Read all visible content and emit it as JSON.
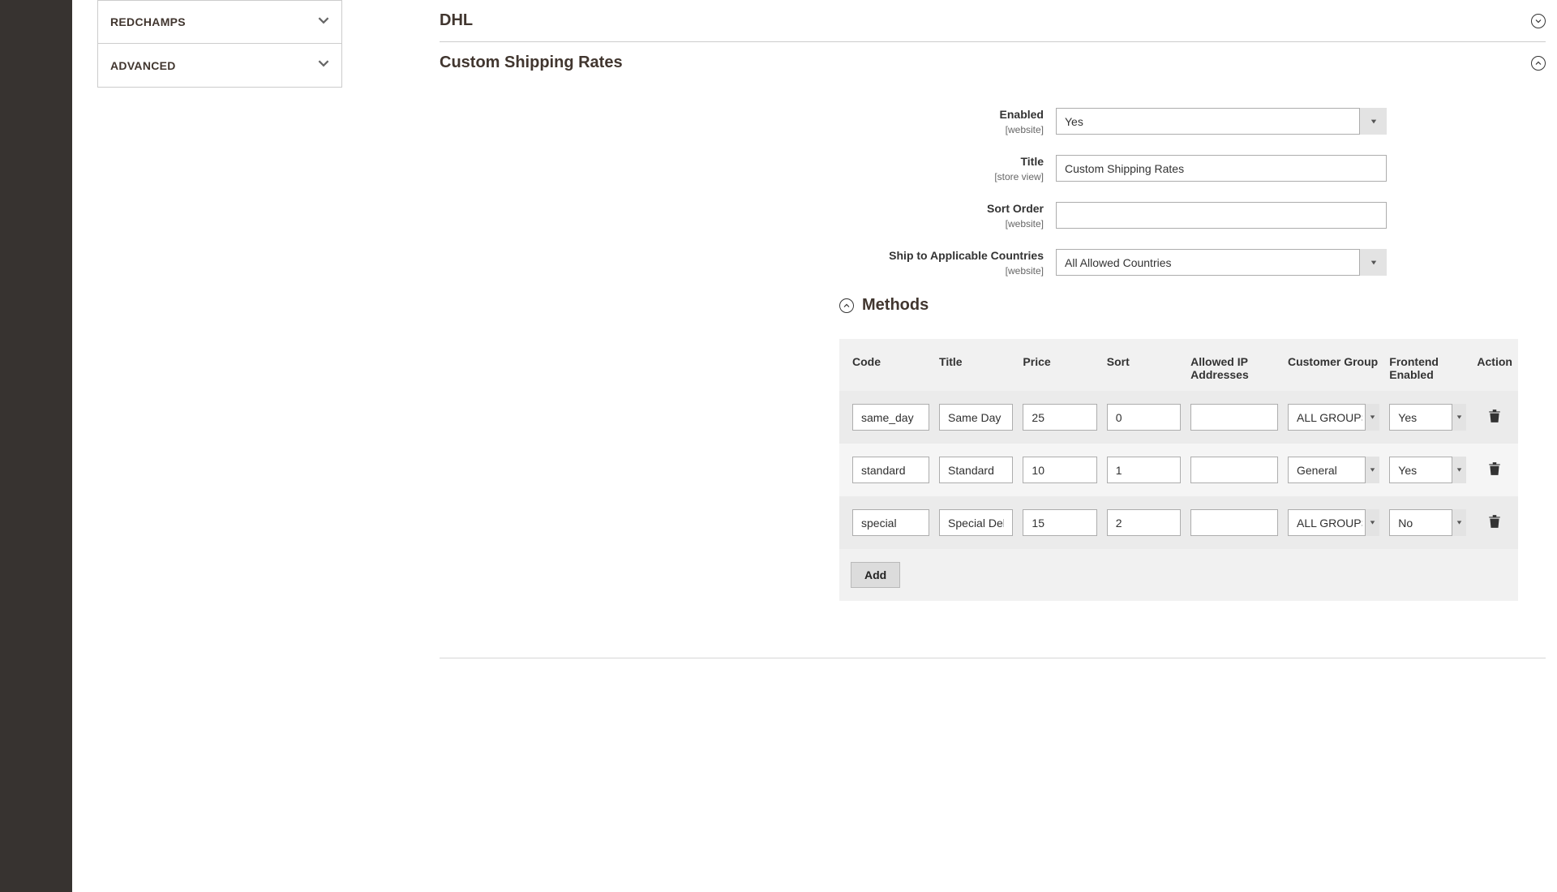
{
  "sidebar": {
    "items": [
      {
        "label": "REDCHAMPS"
      },
      {
        "label": "ADVANCED"
      }
    ]
  },
  "sections": {
    "dhl": {
      "title": "DHL",
      "expanded": false
    },
    "csr": {
      "title": "Custom Shipping Rates",
      "expanded": true
    }
  },
  "form": {
    "enabled": {
      "label": "Enabled",
      "scope": "[website]",
      "value": "Yes"
    },
    "title": {
      "label": "Title",
      "scope": "[store view]",
      "value": "Custom Shipping Rates"
    },
    "sort": {
      "label": "Sort Order",
      "scope": "[website]",
      "value": ""
    },
    "ship": {
      "label": "Ship to Applicable Countries",
      "scope": "[website]",
      "value": "All Allowed Countries"
    }
  },
  "methods": {
    "title": "Methods",
    "headers": {
      "code": "Code",
      "title": "Title",
      "price": "Price",
      "sort": "Sort",
      "ip": "Allowed IP Addresses",
      "group": "Customer Group",
      "fe": "Frontend Enabled",
      "action": "Action"
    },
    "rows": [
      {
        "code": "same_day",
        "title": "Same Day",
        "price": "25",
        "sort": "0",
        "ip": "",
        "group": "ALL GROUPS",
        "fe": "Yes"
      },
      {
        "code": "standard",
        "title": "Standard",
        "price": "10",
        "sort": "1",
        "ip": "",
        "group": "General",
        "fe": "Yes"
      },
      {
        "code": "special",
        "title": "Special Delivery",
        "price": "15",
        "sort": "2",
        "ip": "",
        "group": "ALL GROUPS",
        "fe": "No"
      }
    ],
    "add_label": "Add"
  }
}
